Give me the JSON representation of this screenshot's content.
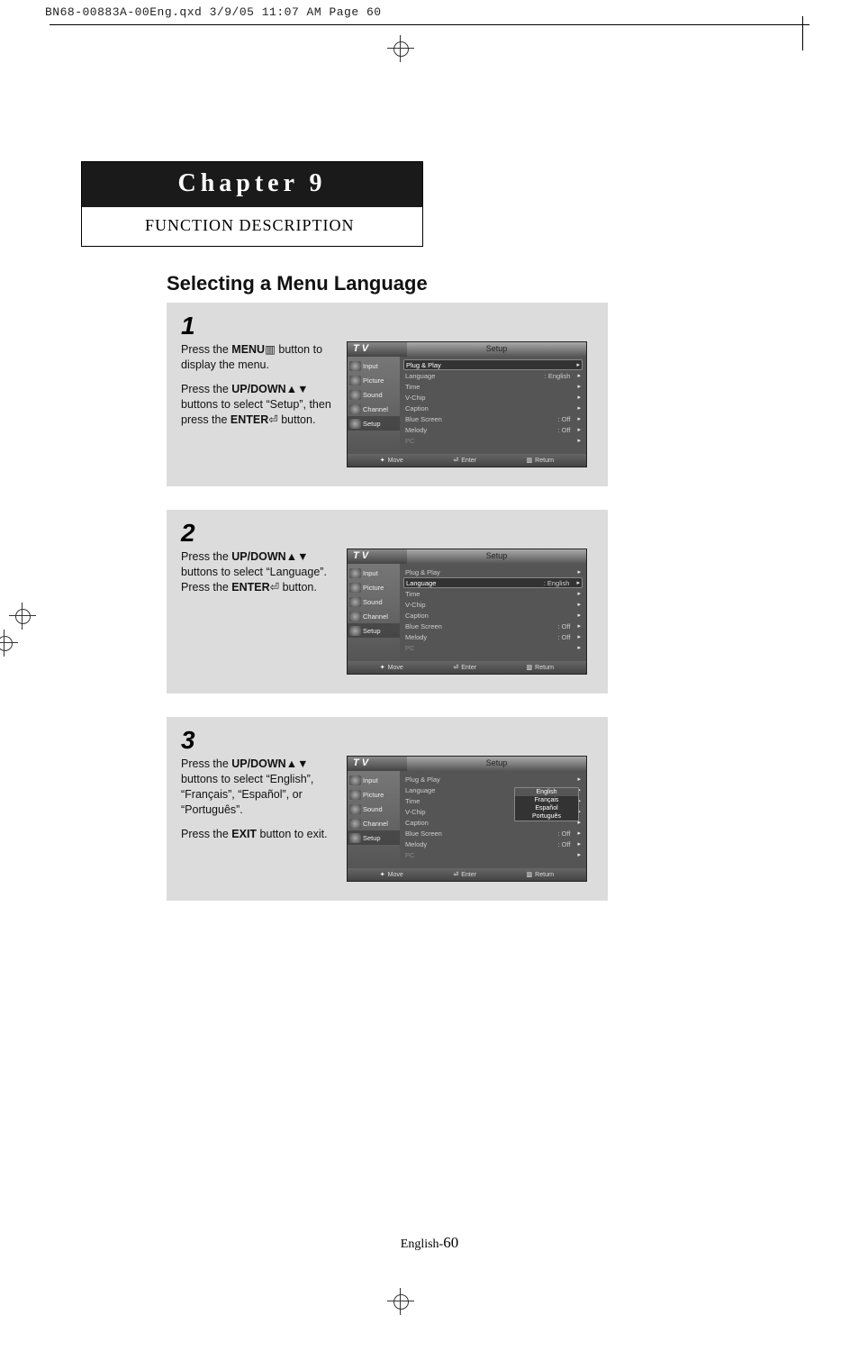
{
  "print_header": "BN68-00883A-00Eng.qxd  3/9/05 11:07 AM  Page 60",
  "chapter": {
    "title": "Chapter 9",
    "subtitle": "FUNCTION DESCRIPTION"
  },
  "section_title": "Selecting a Menu Language",
  "steps": [
    {
      "num": "1",
      "paragraphs": [
        "Press the <b>MENU</b>▥ button to display the menu.",
        "Press the <b>UP/DOWN</b>▲▼ buttons to select “Setup”, then press the <b>ENTER</b>⏎ button."
      ]
    },
    {
      "num": "2",
      "paragraphs": [
        "Press the <b>UP/DOWN</b>▲▼ buttons to select “Language”. Press the <b>ENTER</b>⏎ button."
      ]
    },
    {
      "num": "3",
      "paragraphs": [
        "Press the <b>UP/DOWN</b>▲▼ buttons to select “English”, “Français”, “Español”, or “Português”.",
        "Press the <b>EXIT</b> button to exit."
      ]
    }
  ],
  "osd_common": {
    "tv_label": "T V",
    "screen_title": "Setup",
    "sidebar": [
      "Input",
      "Picture",
      "Sound",
      "Channel",
      "Setup"
    ],
    "hints": {
      "move": "Move",
      "enter": "Enter",
      "ret": "Return"
    }
  },
  "osd1": {
    "rows": [
      {
        "label": "Plug & Play",
        "val": "",
        "hl": true
      },
      {
        "label": "Language",
        "val": ": English"
      },
      {
        "label": "Time",
        "val": ""
      },
      {
        "label": "V-Chip",
        "val": ""
      },
      {
        "label": "Caption",
        "val": ""
      },
      {
        "label": "Blue Screen",
        "val": ": Off"
      },
      {
        "label": "Melody",
        "val": ": Off"
      },
      {
        "label": "PC",
        "val": "",
        "dim": true
      }
    ]
  },
  "osd2": {
    "rows": [
      {
        "label": "Plug & Play",
        "val": ""
      },
      {
        "label": "Language",
        "val": ": English",
        "hl": true
      },
      {
        "label": "Time",
        "val": ""
      },
      {
        "label": "V-Chip",
        "val": ""
      },
      {
        "label": "Caption",
        "val": ""
      },
      {
        "label": "Blue Screen",
        "val": ": Off"
      },
      {
        "label": "Melody",
        "val": ": Off"
      },
      {
        "label": "PC",
        "val": "",
        "dim": true
      }
    ]
  },
  "osd3": {
    "rows": [
      {
        "label": "Plug & Play",
        "val": ""
      },
      {
        "label": "Language",
        "val": ""
      },
      {
        "label": "Time",
        "val": ""
      },
      {
        "label": "V-Chip",
        "val": ""
      },
      {
        "label": "Caption",
        "val": ""
      },
      {
        "label": "Blue Screen",
        "val": ": Off"
      },
      {
        "label": "Melody",
        "val": ": Off"
      },
      {
        "label": "PC",
        "val": "",
        "dim": true
      }
    ],
    "lang_popup": [
      "English",
      "Français",
      "Español",
      "Português"
    ],
    "lang_selected_index": 0
  },
  "footer": {
    "prefix": "English-",
    "page": "60"
  }
}
